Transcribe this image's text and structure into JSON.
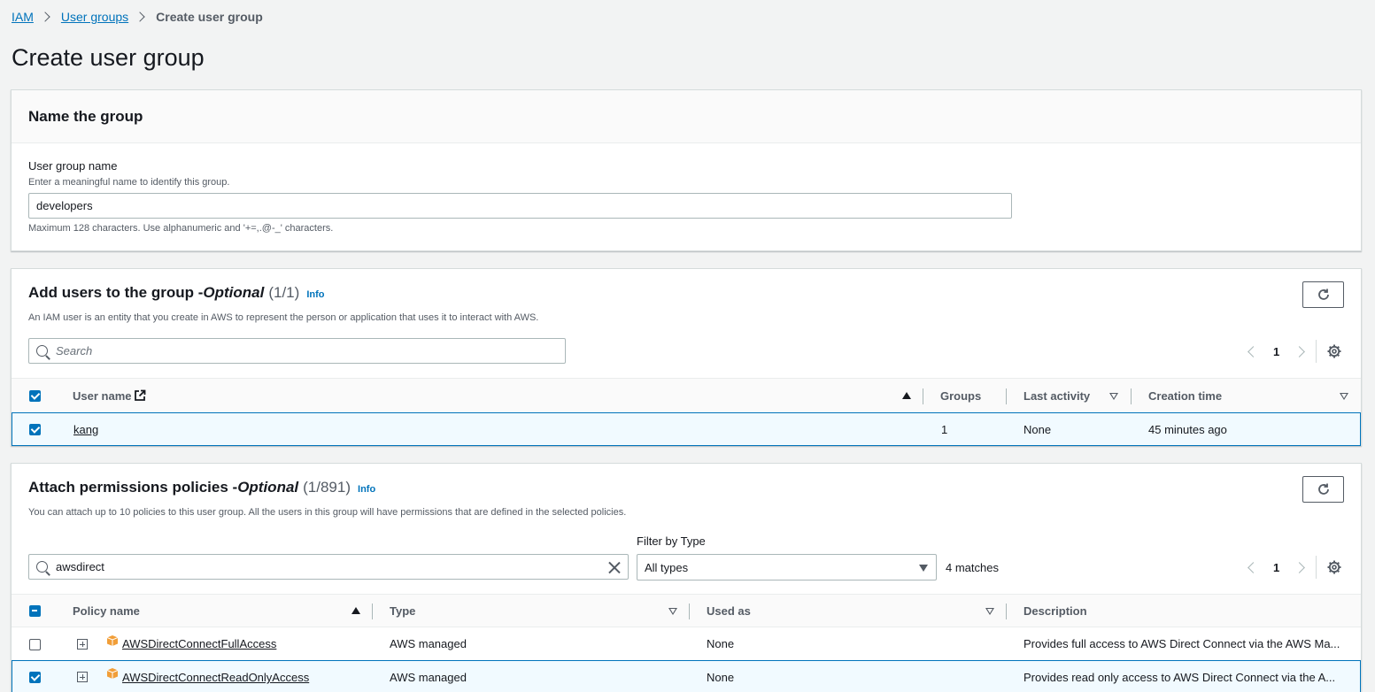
{
  "breadcrumb": {
    "items": [
      "IAM",
      "User groups"
    ],
    "current": "Create user group"
  },
  "page_title": "Create user group",
  "name_card": {
    "title": "Name the group",
    "label": "User group name",
    "description": "Enter a meaningful name to identify this group.",
    "value": "developers",
    "constraint": "Maximum 128 characters. Use alphanumeric and '+=,.@-_' characters."
  },
  "users_card": {
    "title": "Add users to the group - ",
    "optional": "Optional",
    "count": "(1/1)",
    "info": "Info",
    "subtitle": "An IAM user is an entity that you create in AWS to represent the person or application that uses it to interact with AWS.",
    "search_placeholder": "Search",
    "page": "1",
    "columns": [
      "User name",
      "Groups",
      "Last activity",
      "Creation time"
    ],
    "rows": [
      {
        "user_name": "kang",
        "groups": "1",
        "last_activity": "None",
        "creation_time": "45 minutes ago",
        "selected": true
      }
    ]
  },
  "policies_card": {
    "title": "Attach permissions policies - ",
    "optional": "Optional",
    "count": "(1/891)",
    "info": "Info",
    "subtitle": "You can attach up to 10 policies to this user group. All the users in this group will have permissions that are defined in the selected policies.",
    "search_value": "awsdirect",
    "filter_label": "Filter by Type",
    "filter_value": "All types",
    "matches": "4 matches",
    "page": "1",
    "columns": [
      "Policy name",
      "Type",
      "Used as",
      "Description"
    ],
    "rows": [
      {
        "name": "AWSDirectConnectFullAccess",
        "type": "AWS managed",
        "used_as": "None",
        "description": "Provides full access to AWS Direct Connect via the AWS Ma...",
        "selected": false
      },
      {
        "name": "AWSDirectConnectReadOnlyAccess",
        "type": "AWS managed",
        "used_as": "None",
        "description": "Provides read only access to AWS Direct Connect via the A...",
        "selected": true
      }
    ]
  },
  "colors": {
    "link": "#0073bb",
    "selected_bg": "#f1faff",
    "page_bg": "#f2f3f3",
    "package_icon": "#f19e38"
  }
}
